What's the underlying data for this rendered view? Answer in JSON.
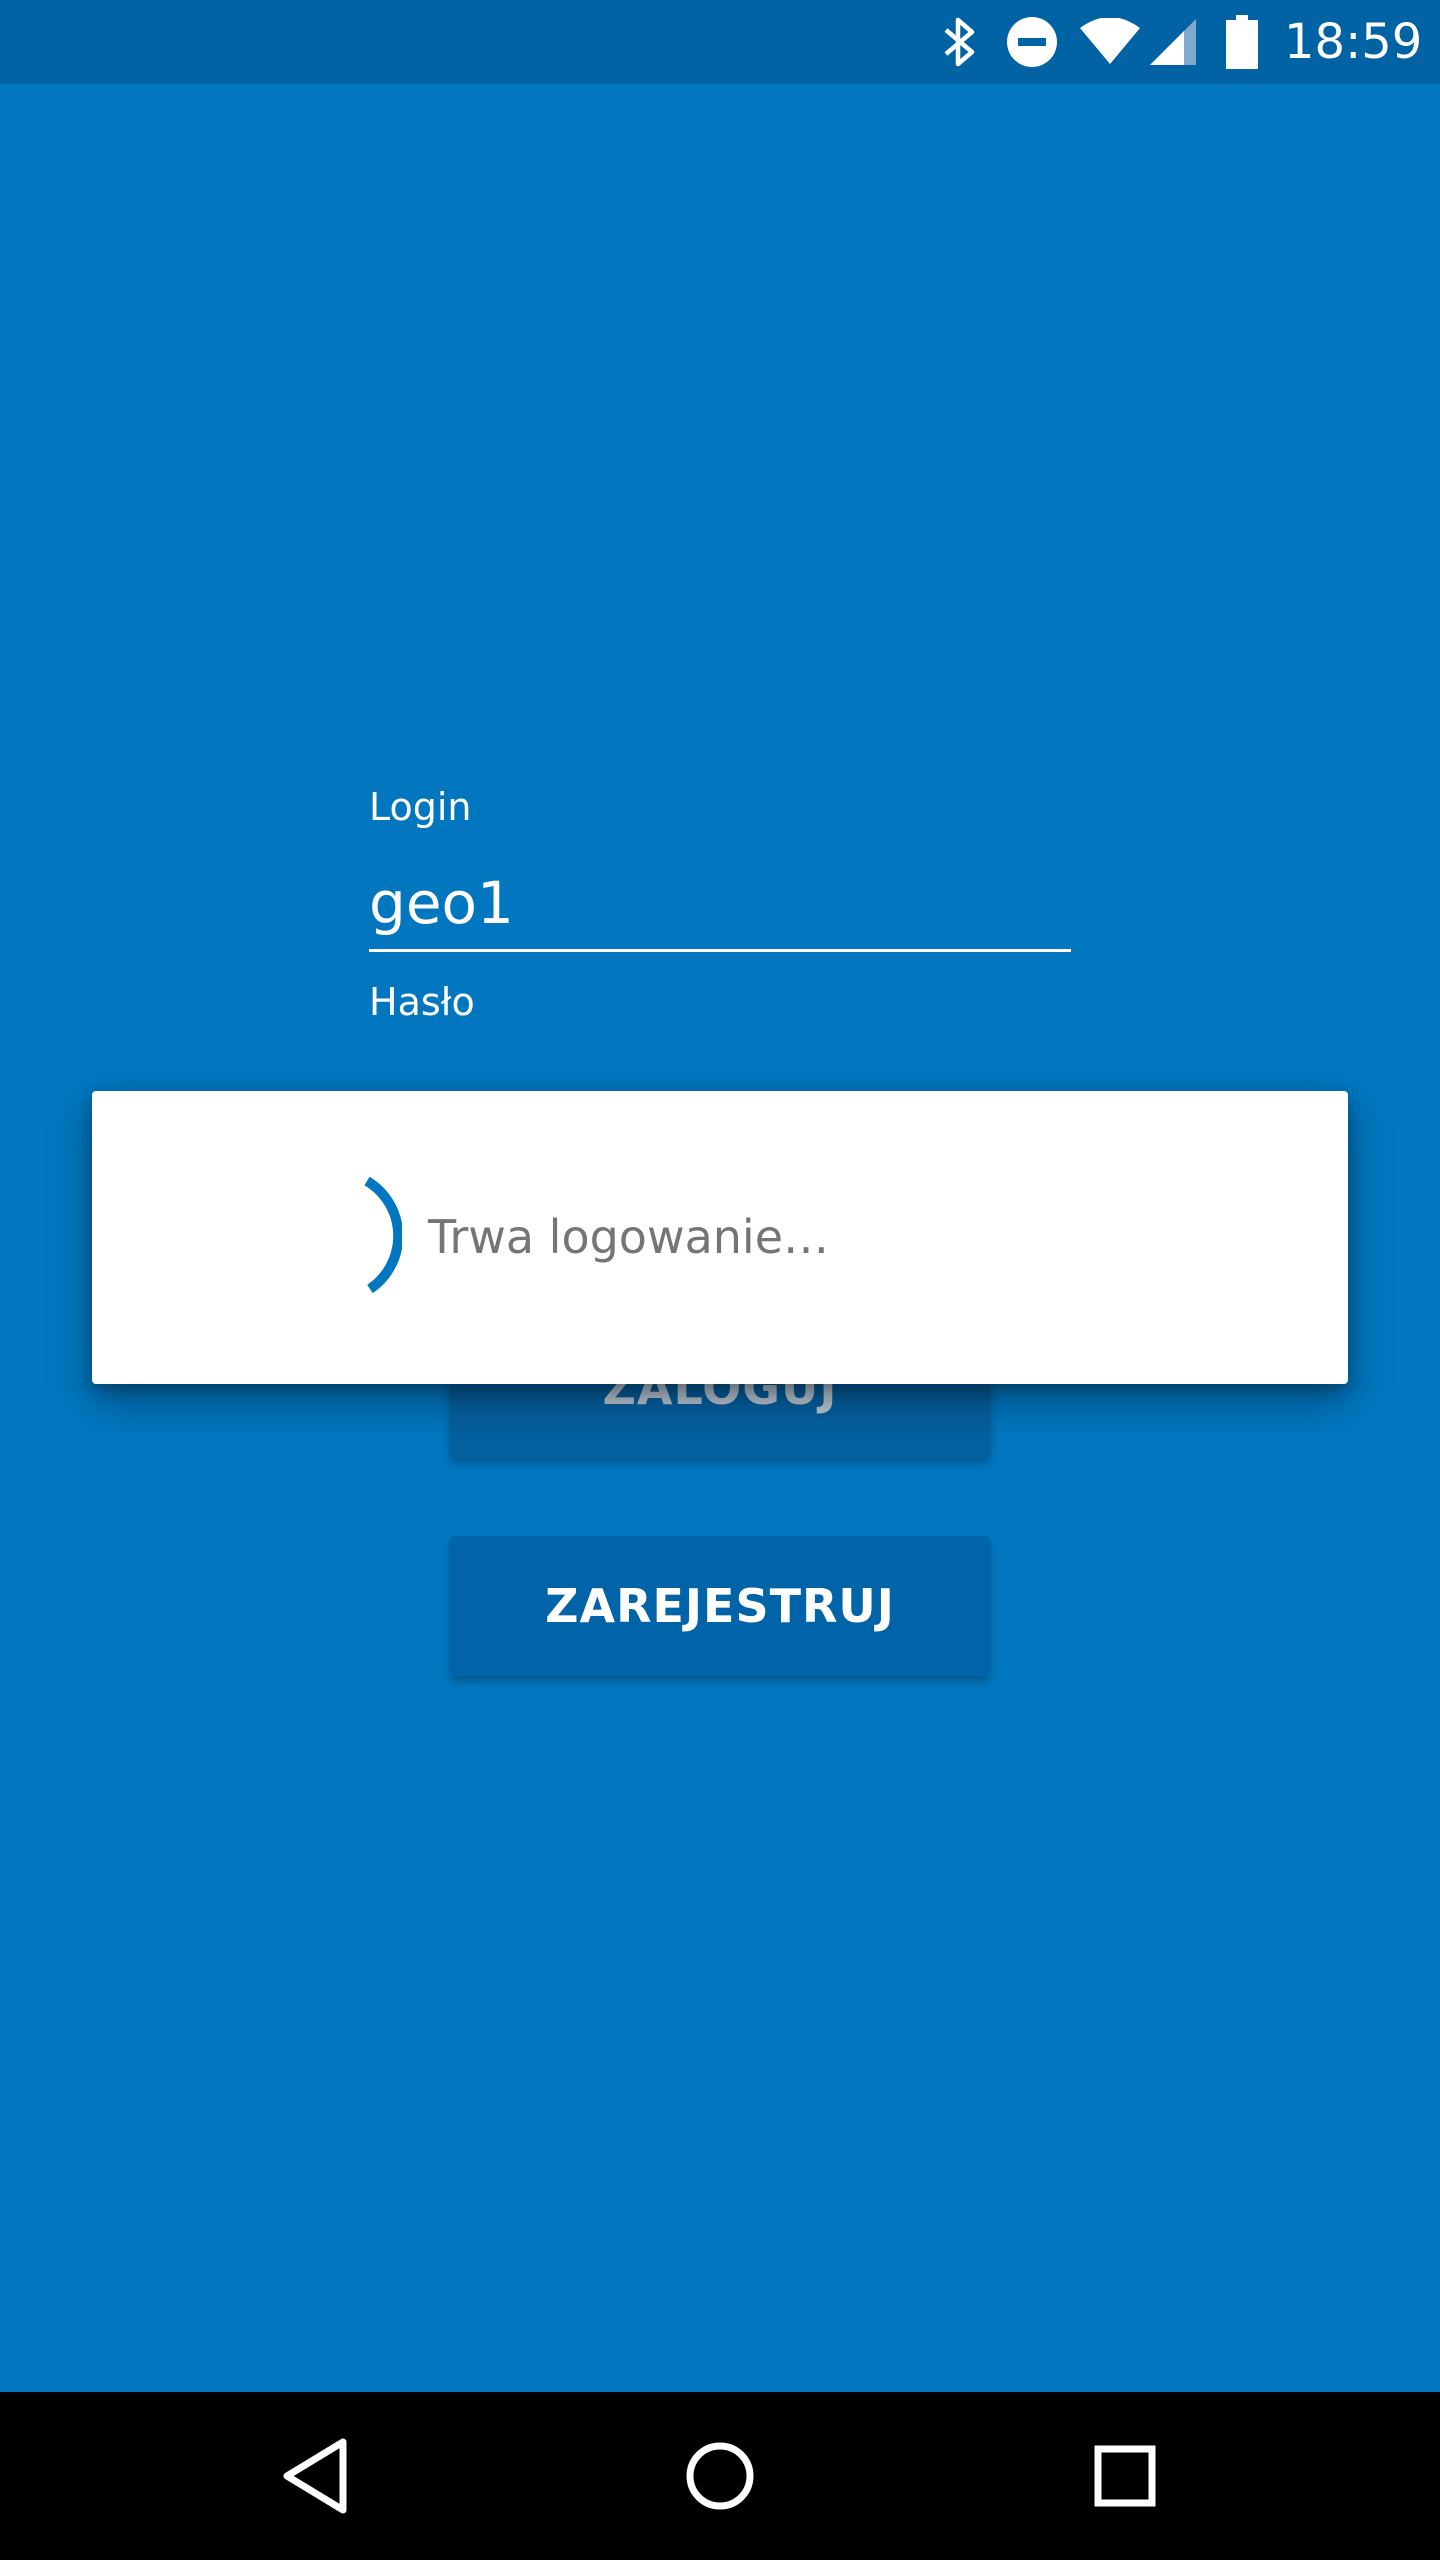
{
  "status_bar": {
    "time": "18:59",
    "icons": [
      "bluetooth-icon",
      "do-not-disturb-icon",
      "wifi-icon",
      "cellular-signal-icon",
      "battery-icon"
    ]
  },
  "form": {
    "login_label": "Login",
    "login_value": "geo1",
    "password_label": "Hasło",
    "login_button": "ZALOGUJ",
    "register_button": "ZAREJESTRUJ"
  },
  "dialog": {
    "message": "Trwa logowanie…",
    "spinner_color": "#0277c0"
  },
  "nav_bar": {
    "icons": [
      "back-icon",
      "home-icon",
      "recents-icon"
    ]
  },
  "colors": {
    "background": "#0277c0",
    "status_bar": "#0263a4",
    "button": "#0264a8"
  }
}
